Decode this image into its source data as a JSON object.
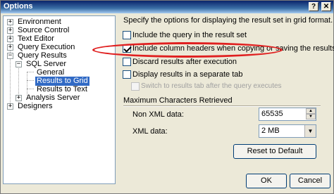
{
  "window": {
    "title": "Options",
    "help_glyph": "?",
    "close_glyph": "✕"
  },
  "tree": [
    {
      "label": "Environment",
      "expander": "+"
    },
    {
      "label": "Source Control",
      "expander": "+"
    },
    {
      "label": "Text Editor",
      "expander": "+"
    },
    {
      "label": "Query Execution",
      "expander": "+"
    },
    {
      "label": "Query Results",
      "expander": "−"
    },
    {
      "label": "SQL Server",
      "expander": "−"
    },
    {
      "label": "General"
    },
    {
      "label": "Results to Grid",
      "selected": true
    },
    {
      "label": "Results to Text"
    },
    {
      "label": "Analysis Server",
      "expander": "+"
    },
    {
      "label": "Designers",
      "expander": "+"
    }
  ],
  "description": "Specify the options for displaying the result set in grid format.",
  "options": [
    {
      "label": "Include the query in the result set",
      "checked": false,
      "disabled": false
    },
    {
      "label": "Include column headers when copying or saving the results",
      "checked": true,
      "disabled": false
    },
    {
      "label": "Discard results after execution",
      "checked": false,
      "disabled": false
    },
    {
      "label": "Display results in a separate tab",
      "checked": false,
      "disabled": false
    },
    {
      "label": "Switch to results tab after the query executes",
      "checked": false,
      "disabled": true
    }
  ],
  "max_chars": {
    "group_label": "Maximum Characters Retrieved",
    "non_xml_label": "Non XML data:",
    "non_xml_value": "65535",
    "xml_label": "XML data:",
    "xml_value": "2 MB"
  },
  "buttons": {
    "reset": "Reset to Default",
    "ok": "OK",
    "cancel": "Cancel"
  },
  "colors": {
    "highlight_ellipse": "#e02020",
    "selection": "#316ac5"
  }
}
